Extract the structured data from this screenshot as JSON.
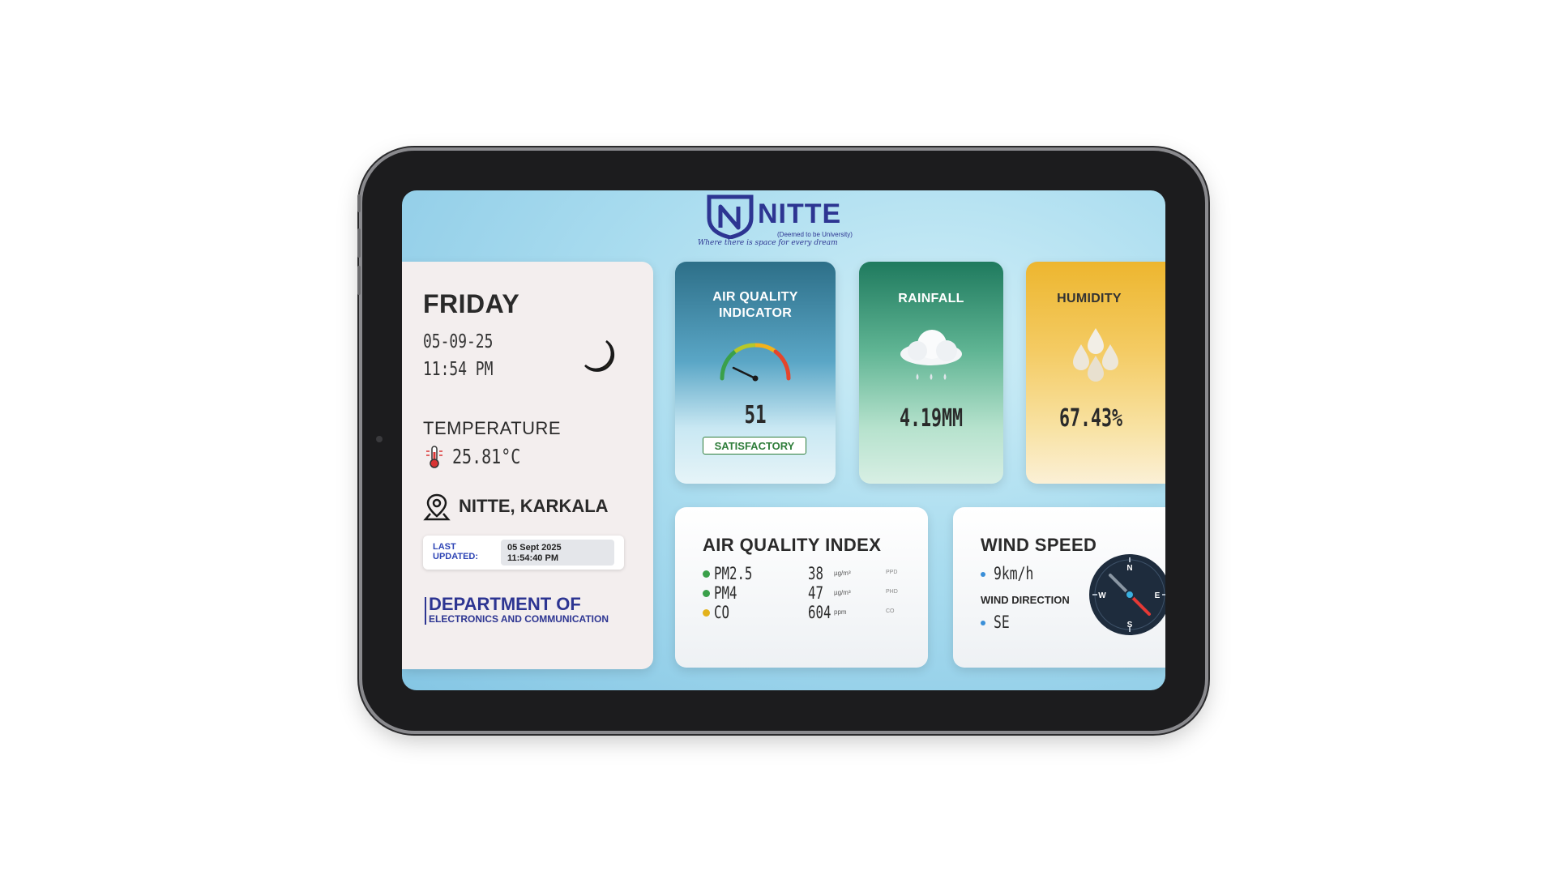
{
  "logo": {
    "word": "NITTE",
    "sub": "(Deemed to be University)",
    "tagline": "Where there is space for every dream"
  },
  "datetime": {
    "day": "FRIDAY",
    "date": "05-09-25",
    "time": "11:54 PM",
    "moon_icon": "crescent-moon-icon"
  },
  "temperature": {
    "label": "TEMPERATURE",
    "value": "25.81°C"
  },
  "location": {
    "name": "NITTE, KARKALA"
  },
  "last_updated": {
    "label": "LAST UPDATED:",
    "date": "05 Sept 2025",
    "time": "11:54:40 PM"
  },
  "department": {
    "line1": "DEPARTMENT OF",
    "line2": "ELECTRONICS AND COMMUNICATION"
  },
  "aq_indicator": {
    "title": "AIR QUALITY INDICATOR",
    "value": "51",
    "status": "SATISFACTORY"
  },
  "rainfall": {
    "title": "RAINFALL",
    "value": "4.19MM"
  },
  "humidity": {
    "title": "HUMIDITY",
    "value": "67.43%"
  },
  "aqi": {
    "title": "AIR QUALITY INDEX",
    "rows": [
      {
        "name": "PM2.5",
        "value": "38",
        "unit": "µg/m³",
        "code": "PPD",
        "color": "#3aa04a"
      },
      {
        "name": "PM4",
        "value": "47",
        "unit": "µg/m³",
        "code": "PHD",
        "color": "#3aa04a"
      },
      {
        "name": "CO",
        "value": "604",
        "unit": "ppm",
        "code": "CO",
        "color": "#e3b21c"
      }
    ]
  },
  "wind": {
    "title": "WIND SPEED",
    "speed": "9km/h",
    "direction_label": "WIND DIRECTION",
    "direction": "SE",
    "compass": {
      "n": "N",
      "e": "E",
      "s": "S",
      "w": "W"
    }
  },
  "colors": {
    "brand": "#2d3592",
    "good": "#2f7d3a"
  }
}
